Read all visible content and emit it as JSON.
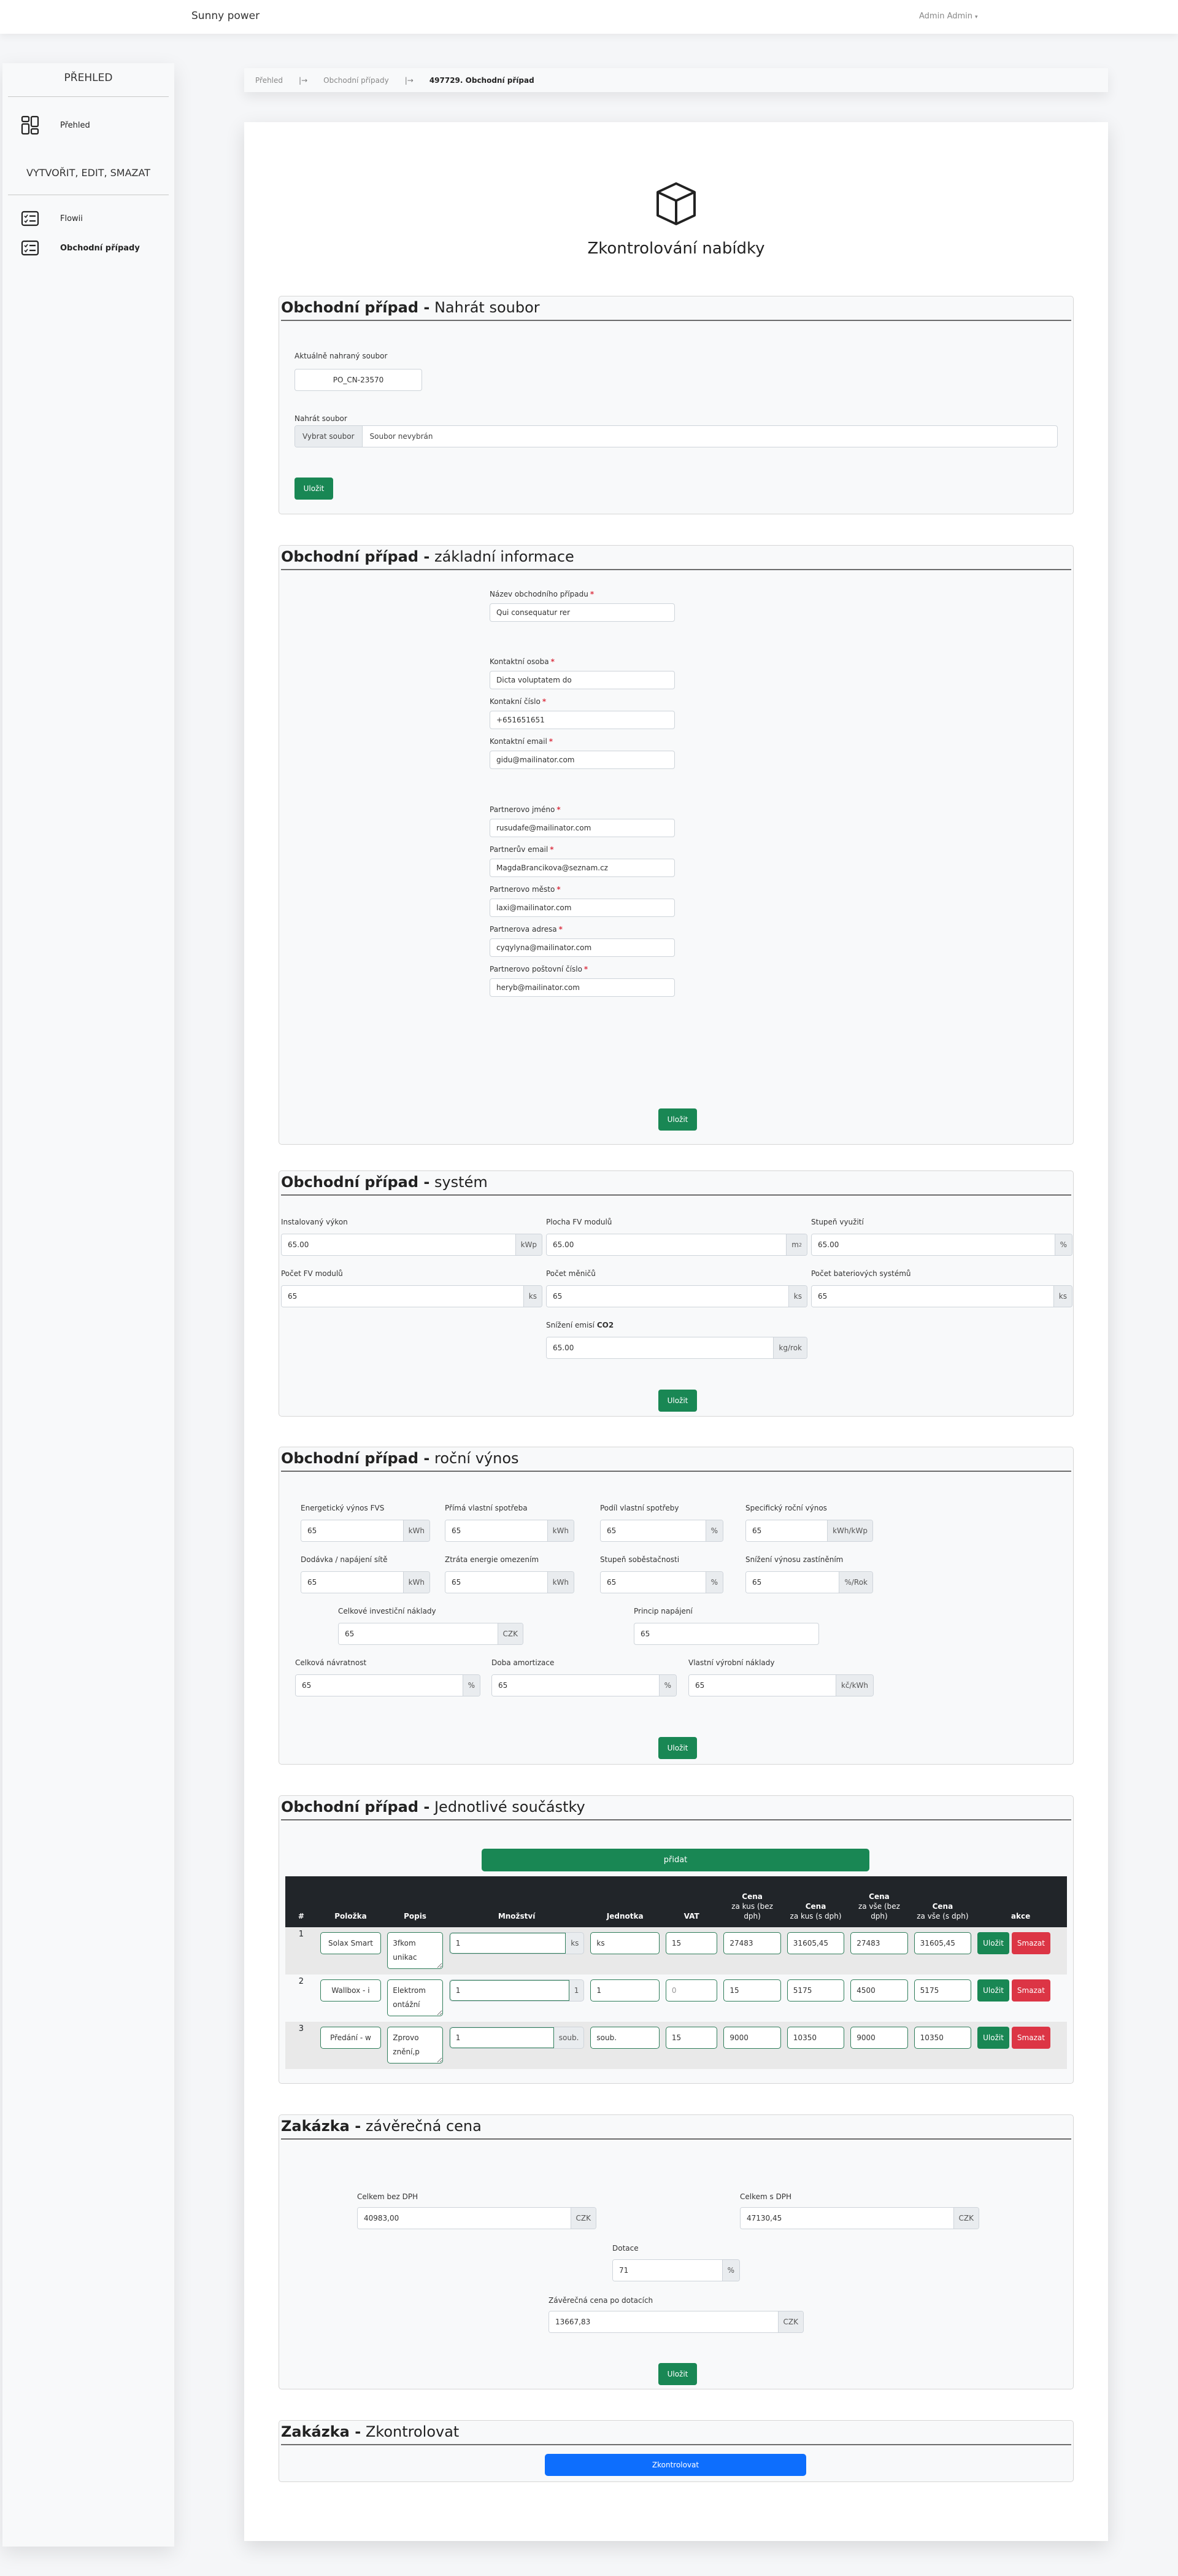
{
  "navbar": {
    "brand": "Sunny power",
    "user": "Admin Admin",
    "caret": "▾"
  },
  "sidebar": {
    "section1": "PŘEHLED",
    "section2": "VYTVOŘIT, EDIT, SMAZAT",
    "items": [
      {
        "label": "Přehled",
        "icon": "dashboard-icon"
      },
      {
        "label": "Flowii",
        "icon": "checklist-icon"
      },
      {
        "label": "Obchodní případy",
        "icon": "checklist-icon",
        "active": true
      }
    ]
  },
  "breadcrumb": {
    "items": [
      "Přehled",
      "Obchodní případy"
    ],
    "separator": "|→",
    "current": "497729. Obchodní případ"
  },
  "page": {
    "icon": "box-icon",
    "title": "Zkontrolování nabídky"
  },
  "save_label": "Uložit",
  "upload": {
    "title_bold": "Obchodní případ -",
    "title_rest": " Nahrát soubor",
    "current_label": "Aktuálně nahraný soubor",
    "current_value": "PO_CN-23570",
    "upload_label": "Nahrát soubor",
    "choose_button": "Vybrat soubor",
    "no_file": "Soubor nevybrán"
  },
  "basic": {
    "title_bold": "Obchodní případ -",
    "title_rest": " základní informace",
    "required_mark": "*",
    "fields": [
      {
        "label": "Název obchodního případu",
        "value": "Qui consequatur rer"
      },
      {
        "label": "Kontaktní osoba",
        "value": "Dicta voluptatem do"
      },
      {
        "label": "Kontakní číslo",
        "value": "+651651651"
      },
      {
        "label": "Kontaktní email",
        "value": "gidu@mailinator.com"
      },
      {
        "label": "Partnerovo jméno",
        "value": "rusudafe@mailinator.com"
      },
      {
        "label": "Partnerův email",
        "value": "MagdaBrancikova@seznam.cz"
      },
      {
        "label": "Partnerovo město",
        "value": "laxi@mailinator.com"
      },
      {
        "label": "Partnerova adresa",
        "value": "cyqylyna@mailinator.com"
      },
      {
        "label": "Partnerovo poštovní číslo",
        "value": "heryb@mailinator.com"
      }
    ]
  },
  "system": {
    "title_bold": "Obchodní případ -",
    "title_rest": " systém",
    "fields": [
      {
        "label": "Instalovaný výkon",
        "value": "65.00",
        "unit": "kWp"
      },
      {
        "label": "Plocha FV modulů",
        "value": "65.00",
        "unit": "m",
        "unit_sup": "2"
      },
      {
        "label": "Stupeň využití",
        "value": "65.00",
        "unit": "%"
      },
      {
        "label": "Počet FV modulů",
        "value": "65",
        "unit": "ks"
      },
      {
        "label": "Počet měničů",
        "value": "65",
        "unit": "ks"
      },
      {
        "label": "Počet bateriových systémů",
        "value": "65",
        "unit": "ks"
      },
      {
        "label": "Snížení emisí ",
        "label_bold": "CO2",
        "value": "65.00",
        "unit": "kg/rok"
      }
    ]
  },
  "yield": {
    "title_bold": "Obchodní případ -",
    "title_rest": " roční výnos",
    "fields": [
      {
        "label": "Energetický výnos FVS",
        "value": "65",
        "unit": "kWh"
      },
      {
        "label": "Přímá vlastní spotřeba",
        "value": "65",
        "unit": "kWh"
      },
      {
        "label": "Podíl vlastní spotřeby",
        "value": "65",
        "unit": "%"
      },
      {
        "label": "Specifický roční výnos",
        "value": "65",
        "unit": "kWh/kWp"
      },
      {
        "label": "Dodávka / napájení sítě",
        "value": "65",
        "unit": "kWh"
      },
      {
        "label": "Ztráta energie omezením",
        "value": "65",
        "unit": "kWh"
      },
      {
        "label": "Stupeň soběstačnosti",
        "value": "65",
        "unit": "%"
      },
      {
        "label": "Snížení výnosu zastíněním",
        "value": "65",
        "unit": "%/Rok"
      },
      {
        "label": "Celkové investiční náklady",
        "value": "65",
        "unit": "CZK"
      },
      {
        "label": "Princip napájení",
        "value": "65"
      },
      {
        "label": "Celková návratnost",
        "value": "65",
        "unit": "%"
      },
      {
        "label": "Doba amortizace",
        "value": "65",
        "unit": "%"
      },
      {
        "label": "Vlastní výrobní náklady",
        "value": "65",
        "unit": "kč/kWh"
      }
    ]
  },
  "components": {
    "title_bold": "Obchodní případ -",
    "title_rest": " Jednotlivé součástky",
    "add_button": "přidat",
    "headers": [
      {
        "main": "#"
      },
      {
        "main": "Položka"
      },
      {
        "main": "Popis"
      },
      {
        "main": "Množství"
      },
      {
        "main": "Jednotka"
      },
      {
        "main": "VAT"
      },
      {
        "main": "Cena",
        "sub": "za kus (bez dph)"
      },
      {
        "main": "Cena",
        "sub": "za kus (s dph)"
      },
      {
        "main": "Cena",
        "sub": "za vše (bez dph)"
      },
      {
        "main": "Cena",
        "sub": "za vše (s dph)"
      },
      {
        "main": "akce"
      }
    ],
    "rows": [
      {
        "num": "1",
        "item": "Solax Smart",
        "desc": "3fkom\nunikac",
        "qty": "1",
        "qty_unit": "ks",
        "unit": "ks",
        "vat": "15",
        "vat_placeholder": "",
        "unit_price": "27483",
        "unit_price_vat": "31605,45",
        "total": "27483",
        "total_vat": "31605,45"
      },
      {
        "num": "2",
        "item": "Wallbox - i",
        "desc": "Elektrom\nontážní",
        "qty": "1",
        "qty_unit": "1",
        "unit": "1",
        "vat": "",
        "vat_placeholder": "0",
        "unit_price": "15",
        "unit_price_vat": "5175",
        "total": "4500",
        "total_vat": "5175"
      },
      {
        "num": "3",
        "item": "Předání - w",
        "desc": "Zprovo\nznění,p",
        "qty": "1",
        "qty_unit": "soub.",
        "unit": "soub.",
        "vat": "15",
        "vat_placeholder": "",
        "unit_price": "9000",
        "unit_price_vat": "10350",
        "total": "9000",
        "total_vat": "10350"
      }
    ],
    "row_save": "Uložit",
    "row_delete": "Smazat"
  },
  "final_price": {
    "title_bold": "Zakázka -",
    "title_rest": " závěrečná cena",
    "total_no_vat": {
      "label": "Celkem bez DPH",
      "value": "40983,00",
      "unit": "CZK"
    },
    "total_vat": {
      "label": "Celkem s DPH",
      "value": "47130,45",
      "unit": "CZK"
    },
    "subsidy": {
      "label": "Dotace",
      "value": "71",
      "unit": "%"
    },
    "final": {
      "label": "Závěrečná cena po dotacích",
      "value": "13667,83",
      "unit": "CZK"
    }
  },
  "check": {
    "title_bold": "Zakázka -",
    "title_rest": " Zkontrolovat",
    "button": "Zkontrolovat"
  },
  "colors": {
    "success": "#198754",
    "danger": "#dc3545",
    "primary": "#0d6efd",
    "table_head": "#212529"
  }
}
